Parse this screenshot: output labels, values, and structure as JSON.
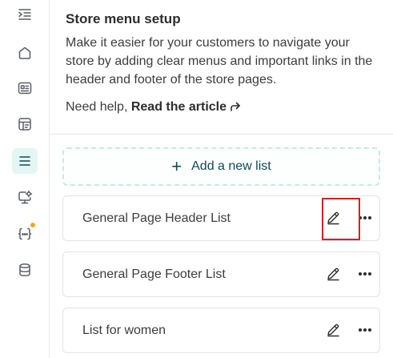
{
  "rail": {
    "items": [
      {
        "icon": "collapse-sidebar-icon"
      },
      {
        "icon": "home-icon"
      },
      {
        "icon": "content-card-icon"
      },
      {
        "icon": "layout-icon"
      },
      {
        "icon": "menu-list-icon",
        "active": true
      },
      {
        "icon": "settings-monitor-icon"
      },
      {
        "icon": "code-braces-icon",
        "notification": true
      },
      {
        "icon": "database-icon"
      }
    ],
    "accent_color": "#e3f6f3",
    "notification_color": "#f5a623"
  },
  "intro": {
    "title": "Store menu setup",
    "description": "Make it easier for your customers to navigate your store by adding clear menus and important links in the header and footer of the store pages.",
    "help_prefix": "Need help, ",
    "help_link": "Read the article"
  },
  "add_list": {
    "plus": "+",
    "label": "Add a new list"
  },
  "lists": [
    {
      "label": "General Page Header List"
    },
    {
      "label": "General Page Footer List"
    },
    {
      "label": "List for women"
    }
  ],
  "highlight_color": "#d32027"
}
